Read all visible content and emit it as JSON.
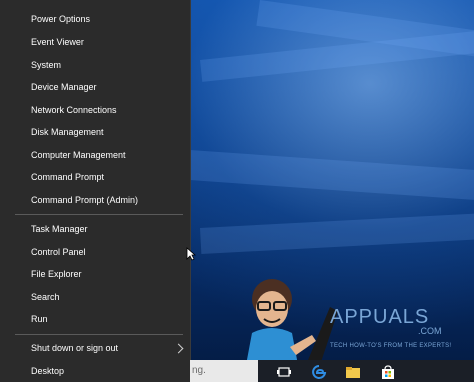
{
  "menu": {
    "items": [
      {
        "label": "Power Options"
      },
      {
        "label": "Event Viewer"
      },
      {
        "label": "System"
      },
      {
        "label": "Device Manager"
      },
      {
        "label": "Network Connections"
      },
      {
        "label": "Disk Management"
      },
      {
        "label": "Computer Management"
      },
      {
        "label": "Command Prompt"
      },
      {
        "label": "Command Prompt (Admin)"
      },
      {
        "label": "Task Manager"
      },
      {
        "label": "Control Panel"
      },
      {
        "label": "File Explorer"
      },
      {
        "label": "Search"
      },
      {
        "label": "Run"
      },
      {
        "label": "Shut down or sign out"
      },
      {
        "label": "Desktop"
      }
    ]
  },
  "taskbar": {
    "search_text": "ng.",
    "icons": [
      "task-view-icon",
      "edge-icon",
      "file-explorer-icon",
      "store-icon"
    ]
  },
  "watermark": {
    "brand": "APPUALS",
    "domain": ".COM",
    "tagline": "TECH HOW-TO'S FROM THE EXPERTS!"
  },
  "colors": {
    "menu_bg": "#2b2b2b",
    "menu_text": "#ffffff",
    "separator": "#5a5a5a",
    "desktop_blue": "#0a3c86",
    "taskbar_bg": "#1b1f27"
  }
}
